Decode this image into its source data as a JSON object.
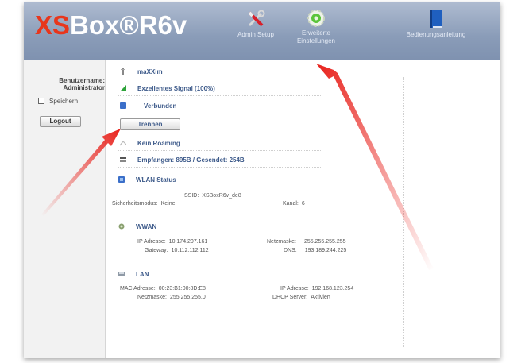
{
  "header": {
    "logo_xs": "XS",
    "logo_rest": "Box®R6v",
    "nav": [
      {
        "label": "Admin Setup",
        "icon": "tools-icon"
      },
      {
        "label": "Erweiterte Einstellungen",
        "icon": "gear-icon"
      },
      {
        "label": "Bedienungsanleitung",
        "icon": "book-icon"
      }
    ]
  },
  "sidebar": {
    "user_label": "Benutzername: Administrator",
    "save_label": "Speichern",
    "logout_label": "Logout"
  },
  "status": {
    "network": "maXXim",
    "signal": "Exzellentes Signal (100%)",
    "connection": "Verbunden",
    "disconnect_label": "Trennen",
    "roaming": "Kein Roaming",
    "traffic": "Empfangen: 895B / Gesendet: 254B"
  },
  "wlan": {
    "title": "WLAN Status",
    "ssid_label": "SSID:",
    "ssid": "XSBoxR6v_de8",
    "security_label": "Sicherheitsmodus:",
    "security": "Keine",
    "channel_label": "Kanal:",
    "channel": "6"
  },
  "wwan": {
    "title": "WWAN",
    "ip_label": "IP Adresse:",
    "ip": "10.174.207.161",
    "gateway_label": "Gateway:",
    "gateway": "10.112.112.112",
    "netmask_label": "Netzmaske:",
    "netmask": "255.255.255.255",
    "dns_label": "DNS:",
    "dns": "193.189.244.225"
  },
  "lan": {
    "title": "LAN",
    "mac_label": "MAC Adresse:",
    "mac": "00:23:B1:00:8D:E8",
    "netmask_label": "Netzmaske:",
    "netmask": "255.255.255.0",
    "ip_label": "IP Adresse:",
    "ip": "192.168.123.254",
    "dhcp_label": "DHCP Server:",
    "dhcp": "Aktiviert"
  },
  "colors": {
    "header": "#8a9cb8",
    "logo_accent": "#e8361c",
    "label_blue": "#3d5a8a",
    "annotation_arrow": "#e8221c"
  }
}
